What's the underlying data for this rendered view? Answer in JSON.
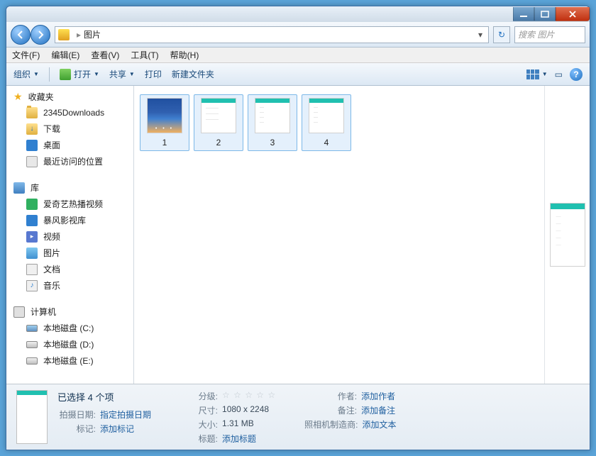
{
  "window": {
    "address_path": "图片",
    "search_placeholder": "搜索 图片"
  },
  "menubar": [
    "文件(F)",
    "编辑(E)",
    "查看(V)",
    "工具(T)",
    "帮助(H)"
  ],
  "toolbar": {
    "organize": "组织",
    "open": "打开",
    "share": "共享",
    "print": "打印",
    "new_folder": "新建文件夹"
  },
  "sidebar": {
    "favorites": {
      "label": "收藏夹",
      "items": [
        {
          "label": "2345Downloads",
          "icon": "folder"
        },
        {
          "label": "下载",
          "icon": "dl"
        },
        {
          "label": "桌面",
          "icon": "desk"
        },
        {
          "label": "最近访问的位置",
          "icon": "recent"
        }
      ]
    },
    "libraries": {
      "label": "库",
      "items": [
        {
          "label": "爱奇艺热播视频",
          "icon": "green"
        },
        {
          "label": "暴风影视库",
          "icon": "blue"
        },
        {
          "label": "视频",
          "icon": "video"
        },
        {
          "label": "图片",
          "icon": "pic2"
        },
        {
          "label": "文档",
          "icon": "doc"
        },
        {
          "label": "音乐",
          "icon": "music"
        }
      ]
    },
    "computer": {
      "label": "计算机",
      "items": [
        {
          "label": "本地磁盘 (C:)",
          "icon": "drive c"
        },
        {
          "label": "本地磁盘 (D:)",
          "icon": "drive"
        },
        {
          "label": "本地磁盘 (E:)",
          "icon": "drive"
        }
      ]
    }
  },
  "thumbnails": [
    {
      "name": "1",
      "cls": "t1"
    },
    {
      "name": "2",
      "cls": "t2"
    },
    {
      "name": "3",
      "cls": "t3"
    },
    {
      "name": "4",
      "cls": "t4"
    }
  ],
  "details": {
    "title": "已选择 4 个项",
    "shot_date_label": "拍摄日期:",
    "shot_date_value": "指定拍摄日期",
    "tag_label": "标记:",
    "tag_value": "添加标记",
    "rating_label": "分级:",
    "size_label": "尺寸:",
    "size_value": "1080 x 2248",
    "filesize_label": "大小:",
    "filesize_value": "1.31 MB",
    "title2_label": "标题:",
    "title2_value": "添加标题",
    "author_label": "作者:",
    "author_value": "添加作者",
    "note_label": "备注:",
    "note_value": "添加备注",
    "cam_label": "照相机制造商:",
    "cam_value": "添加文本"
  }
}
